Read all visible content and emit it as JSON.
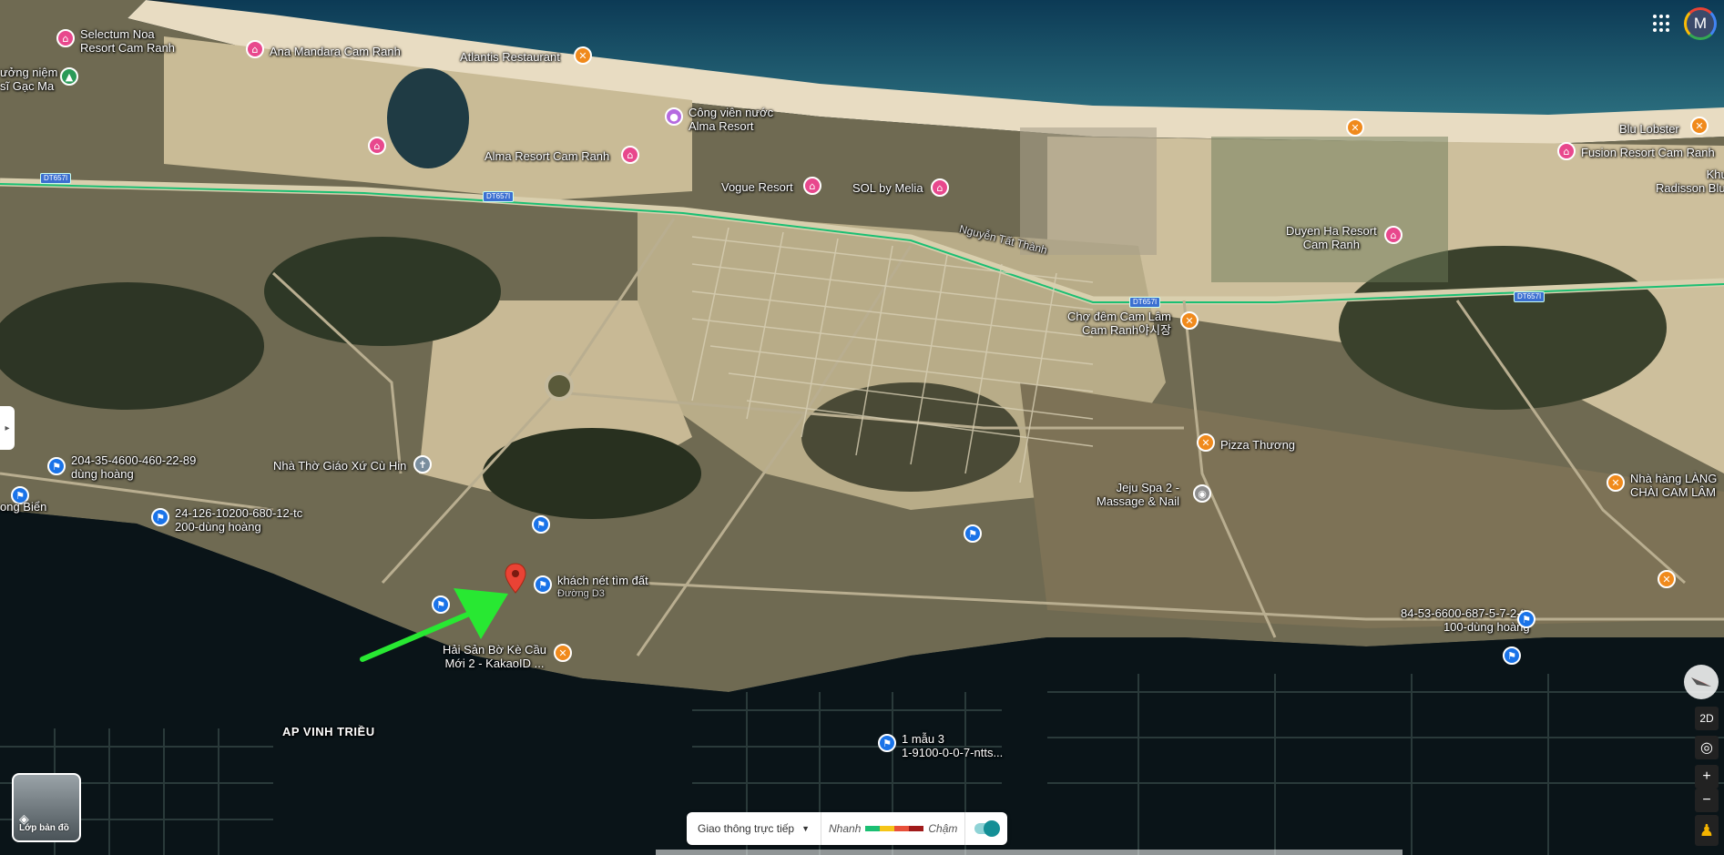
{
  "header": {
    "apps_icon": "apps-grid-icon",
    "avatar_letter": "M"
  },
  "labels": {
    "selectum": "Selectum Noa\nResort Cam Ranh",
    "ana_mandara": "Ana Mandara Cam Ranh",
    "atlantis": "Atlantis Restaurant",
    "khu_tuong_niem": "ưởng niệm\nsĩ Gạc Ma",
    "cong_vien_nuoc": "Công viên nước\nAlma Resort",
    "alma_resort": "Alma Resort Cam Ranh",
    "vogue": "Vogue Resort",
    "sol": "SOL by Melia",
    "blu_lobster": "Blu Lobster",
    "fusion": "Fusion Resort Cam Ranh",
    "khu_radisson": "Khu n\nRadisson Blu C",
    "duyen_ha": "Duyen Ha Resort\nCam Ranh",
    "nguyen_tat_thanh": "Nguyễn Tất Thành",
    "cho_dem": "Chợ đêm Cam Lâm\nCam Ranh야시장",
    "pizza": "Pizza Thương",
    "nha_hang_lang": "Nhà hàng LÀNG\nCHÀI CAM LÂM",
    "jeju": "Jeju Spa 2 -\nMassage & Nail",
    "nha_tho": "Nhà Thờ Giáo Xứ Cù Hin",
    "flag_204": "204-35-4600-460-22-89\ndùng hoàng",
    "flag_24": "24-126-10200-680-12-tc\n200-dùng hoàng",
    "ong_bien": "ong Biển",
    "khach_net": "khách nét tìm đất",
    "duong_d3": "Đường D3",
    "hai_san": "Hải Sản Bờ Kè Cầu\nMới 2 - KakaoID ...",
    "ap_vinh_trieu": "AP VINH TRIỀU",
    "flag_84": "84-53-6600-687-5-7-2-tc\n100-dùng hoàng",
    "flag_1mau": "1 mẫu 3\n1-9100-0-0-7-ntts..."
  },
  "road_shields": [
    "DT657I",
    "DT657I",
    "DT657I",
    "DT657I"
  ],
  "controls": {
    "layers_label": "Lớp bản đồ",
    "mode_2d": "2D",
    "zoom_in": "+",
    "zoom_out": "−"
  },
  "traffic": {
    "select_label": "Giao thông trực tiếp",
    "fast_label": "Nhanh",
    "slow_label": "Chậm",
    "colors": [
      "#1bbf73",
      "#f5c518",
      "#e8503a",
      "#a01a1a"
    ]
  }
}
